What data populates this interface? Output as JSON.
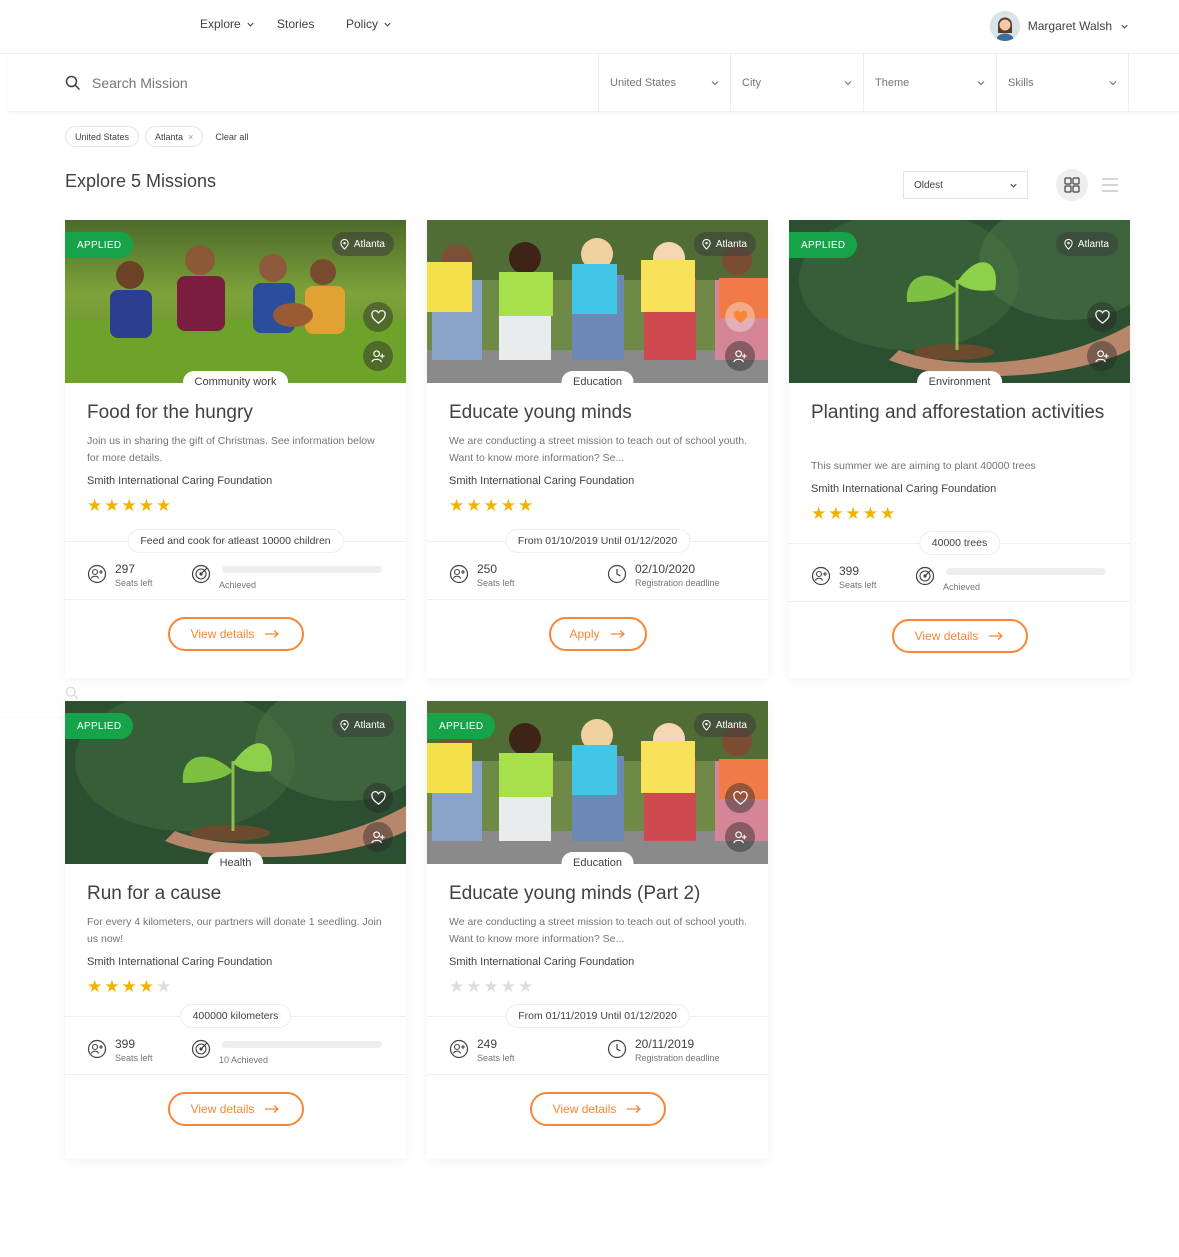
{
  "nav": {
    "explore": "Explore",
    "stories": "Stories",
    "policy": "Policy",
    "user_name": "Margaret Walsh"
  },
  "search": {
    "placeholder": "Search Mission",
    "country": "United States",
    "city": "City",
    "theme": "Theme",
    "skills": "Skills"
  },
  "chips": {
    "items": [
      "United States",
      "Atlanta"
    ],
    "clear": "Clear all"
  },
  "explore": {
    "title": "Explore 5 Missions",
    "sort": "Oldest"
  },
  "colors": {
    "accent": "#f88634",
    "applied": "#16a34a",
    "star": "#f0b400"
  },
  "cards": [
    {
      "applied": "APPLIED",
      "location": "Atlanta",
      "theme": "Community work",
      "title": "Food for the hungry",
      "desc": "Join us in sharing the gift of Christmas. See information below for more details.",
      "org": "Smith International Caring Foundation",
      "rating": 5,
      "info": "Feed and cook for atleast 10000 children",
      "seats": "297",
      "seats_label": "Seats left",
      "stat2_label": "Achieved",
      "progress": 0,
      "cta": "View details"
    },
    {
      "applied": "",
      "location": "Atlanta",
      "theme": "Education",
      "title": "Educate young minds",
      "desc": "We are conducting a street mission to teach out of school youth. Want to know more information? Se...",
      "org": "Smith International Caring Foundation",
      "rating": 5,
      "info": "From 01/10/2019 Until 01/12/2020",
      "seats": "250",
      "seats_label": "Seats left",
      "deadline": "02/10/2020",
      "deadline_label": "Registration deadline",
      "cta": "Apply"
    },
    {
      "applied": "APPLIED",
      "location": "Atlanta",
      "theme": "Environment",
      "title": "Planting and afforestation activities",
      "desc": "This summer we are aiming to plant 40000 trees",
      "org": "Smith International Caring Foundation",
      "rating": 5,
      "info": "40000 trees",
      "seats": "399",
      "seats_label": "Seats left",
      "stat2_label": "Achieved",
      "progress": 0,
      "cta": "View details"
    },
    {
      "applied": "APPLIED",
      "location": "Atlanta",
      "theme": "Health",
      "title": "Run for a cause",
      "desc": "For every 4 kilometers, our partners will donate 1 seedling. Join us now!",
      "org": "Smith International Caring Foundation",
      "rating": 4,
      "info": "400000 kilometers",
      "seats": "399",
      "seats_label": "Seats left",
      "stat2_label": "10 Achieved",
      "progress": 0,
      "cta": "View details"
    },
    {
      "applied": "APPLIED",
      "location": "Atlanta",
      "theme": "Education",
      "title": "Educate young minds (Part 2)",
      "desc": "We are conducting a street mission to teach out of school youth. Want to know more information? Se...",
      "org": "Smith International Caring Foundation",
      "rating": 0,
      "info": "From 01/11/2019 Until 01/12/2020",
      "seats": "249",
      "seats_label": "Seats left",
      "deadline": "20/11/2019",
      "deadline_label": "Registration deadline",
      "cta": "View details"
    }
  ]
}
